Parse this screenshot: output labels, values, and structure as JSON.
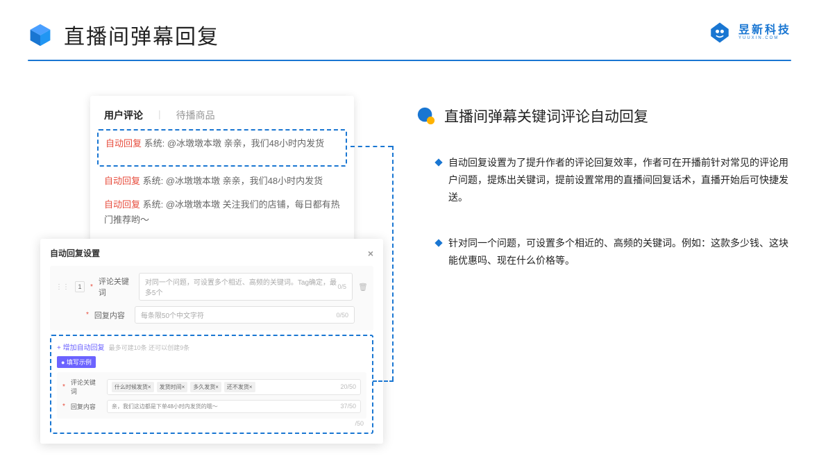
{
  "header": {
    "title": "直播间弹幕回复"
  },
  "brand": {
    "name": "昱新科技",
    "sub": "YUUXIN.COM"
  },
  "panelTop": {
    "tab1": "用户评论",
    "tab2": "待播商品",
    "c1_tag": "自动回复",
    "c1": " 系统: @冰墩墩本墩 亲亲，我们48小时内发货",
    "c2_tag": "自动回复",
    "c2": " 系统: @冰墩墩本墩 亲亲，我们48小时内发货",
    "c3_tag": "自动回复",
    "c3": " 系统: @冰墩墩本墩 关注我们的店铺，每日都有热门推荐哟～"
  },
  "panelBottom": {
    "title": "自动回复设置",
    "idx": "1",
    "lbl1": "评论关键词",
    "ph1": "对同一个问题，可设置多个相近、高频的关键词。Tag确定，最多5个",
    "ct1": "0/5",
    "lbl2": "回复内容",
    "ph2": "每条限50个中文字符",
    "ct2": "0/50",
    "add": "+ 增加自动回复",
    "addnote": "最多可建10条 还可以创建9条",
    "exbadge": "● 填写示例",
    "exlbl1": "评论关键词",
    "chip1": "什么时候发货×",
    "chip2": "发货时间×",
    "chip3": "多久发货×",
    "chip4": "还不发货×",
    "exct1": "20/50",
    "exlbl2": "回复内容",
    "extxt": "亲，我们这边都是下单48小时内发货的哦～",
    "exct2": "37/50",
    "oc": "/50"
  },
  "right": {
    "title": "直播间弹幕关键词评论自动回复",
    "b1": "自动回复设置为了提升作者的评论回复效率，作者可在开播前针对常见的评论用户问题，提炼出关键词，提前设置常用的直播间回复话术，直播开始后可快捷发送。",
    "b2": "针对同一个问题，可设置多个相近的、高频的关键词。例如：这款多少钱、这块能优惠吗、现在什么价格等。"
  }
}
